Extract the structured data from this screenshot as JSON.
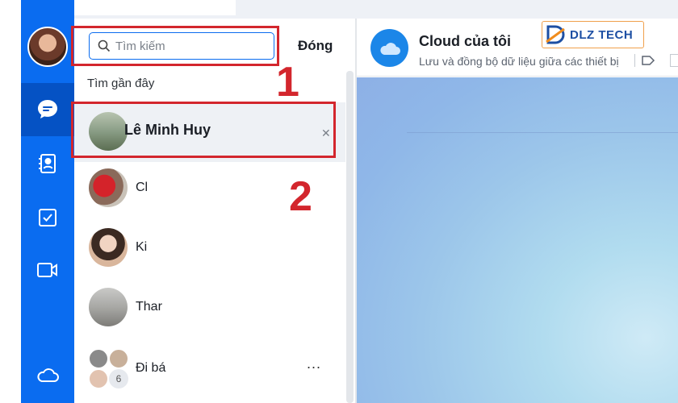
{
  "search": {
    "placeholder": "Tìm kiếm",
    "close_label": "Đóng",
    "recent_label": "Tìm gần đây"
  },
  "recent_contacts": [
    {
      "name": "Lê Minh Huy",
      "selected": true
    },
    {
      "name": "Cl"
    },
    {
      "name": "Ki"
    },
    {
      "name": "Thar"
    },
    {
      "name": "Đi bá",
      "members_extra": "6",
      "more": "..."
    }
  ],
  "annotations": [
    "1",
    "2"
  ],
  "conversation": {
    "title": "Cloud của tôi",
    "subtitle": "Lưu và đồng bộ dữ liệu giữa các thiết bị"
  },
  "logo": {
    "text": "DLZ TECH"
  },
  "colors": {
    "rail": "#0a6cf0",
    "rail_active": "#0552c4",
    "annotation_red": "#d3262d",
    "cloud_avatar": "#1b86e8"
  },
  "icons": {
    "nav": [
      "chat-icon",
      "contacts-icon",
      "todo-icon",
      "video-icon",
      "cloud-icon"
    ]
  }
}
